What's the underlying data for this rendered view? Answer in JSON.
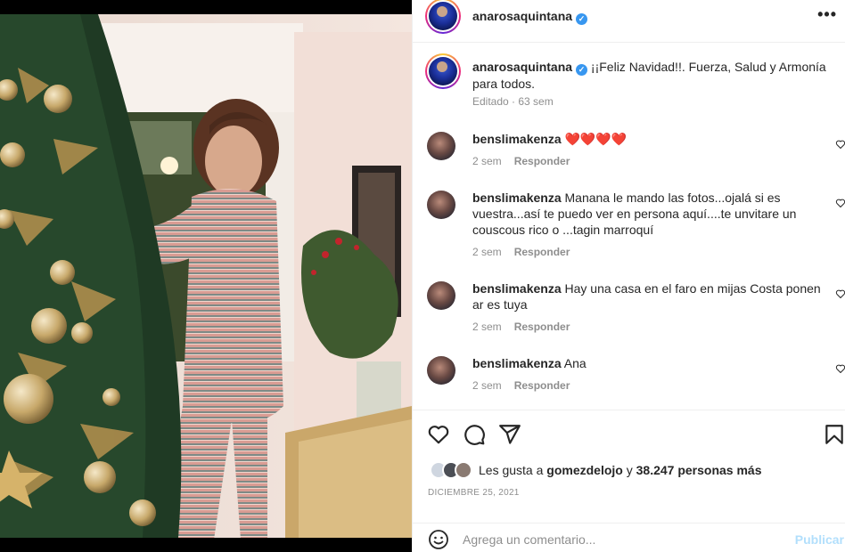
{
  "post": {
    "username": "anarosaquintana",
    "caption": "¡¡Feliz Navidad!!. Fuerza, Salud y Armonía para todos.",
    "caption_edited": "Editado",
    "caption_age": "63 sem"
  },
  "comments": [
    {
      "user": "benslimakenza",
      "text": "❤️❤️❤️❤️",
      "age": "2 sem",
      "reply": "Responder"
    },
    {
      "user": "benslimakenza",
      "text": "Manana le mando las fotos...ojalá si es vuestra...así te puedo ver en persona aquí....te unvitare un couscous rico o ...tagin marroquí",
      "age": "2 sem",
      "reply": "Responder"
    },
    {
      "user": "benslimakenza",
      "text": "Hay una casa en el faro en mijas Costa ponen ar es tuya",
      "age": "2 sem",
      "reply": "Responder"
    },
    {
      "user": "benslimakenza",
      "text": "Ana",
      "age": "2 sem",
      "reply": "Responder"
    }
  ],
  "likes": {
    "prefix": "Les gusta a",
    "user": "gomezdelojo",
    "joiner": "y",
    "count": "38.247 personas más"
  },
  "date": "DICIEMBRE 25, 2021",
  "add_comment": {
    "placeholder": "Agrega un comentario...",
    "post_label": "Publicar"
  },
  "colors": {
    "verified": "#3897f0",
    "publish_disabled": "#b2dffc",
    "meta_gray": "#8e8e8e"
  },
  "icons": [
    "more-options-icon",
    "verified-badge-icon",
    "heart-icon",
    "comment-icon",
    "share-icon",
    "bookmark-icon",
    "emoji-icon"
  ]
}
